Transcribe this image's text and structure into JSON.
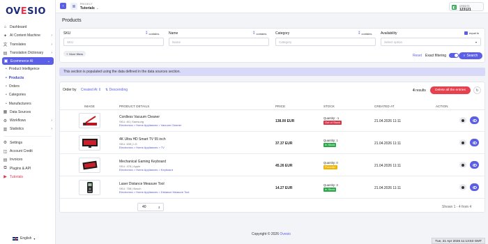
{
  "brand": {
    "logo_pre": "OV",
    "logo_o": "E",
    "logo_post": "SIO"
  },
  "sidebar": {
    "items": [
      {
        "label": "Dashboard",
        "icon": "home-icon"
      },
      {
        "label": "AI Content Machine",
        "icon": "sparkle-icon",
        "chevron": true
      },
      {
        "label": "Translates",
        "icon": "translate-icon",
        "chevron": true
      },
      {
        "label": "Translation Dictionary",
        "icon": "book-icon",
        "chevron": true
      },
      {
        "label": "Ecommerce AI",
        "icon": "cart-icon",
        "chevron": true,
        "active": true
      }
    ],
    "sub_items": [
      {
        "label": "Product Intelligence"
      },
      {
        "label": "Products",
        "active": true
      },
      {
        "label": "Orders"
      },
      {
        "label": "Categories"
      },
      {
        "label": "Manufacturers"
      }
    ],
    "items2": [
      {
        "label": "Data Sources",
        "icon": "database-icon"
      },
      {
        "label": "Workflows",
        "icon": "workflow-icon",
        "chevron": true
      },
      {
        "label": "Statistics",
        "icon": "chart-icon",
        "chevron": true
      }
    ],
    "items3": [
      {
        "label": "Settings",
        "icon": "gear-icon"
      },
      {
        "label": "Account Credit",
        "icon": "credit-icon"
      },
      {
        "label": "Invoices",
        "icon": "invoice-icon"
      },
      {
        "label": "Plugins & API",
        "icon": "plugin-icon"
      },
      {
        "label": "Tutorials",
        "icon": "youtube-icon"
      }
    ],
    "language": "English"
  },
  "topbar": {
    "project_label": "PROJECT",
    "project_name": "Tutorials",
    "credits_label": "CREDITS",
    "credits_value": "123121"
  },
  "page": {
    "title": "Products"
  },
  "filters": {
    "sku": {
      "label": "SKU",
      "mode": "contains",
      "placeholder": "SKU"
    },
    "name": {
      "label": "Name",
      "mode": "contains",
      "placeholder": "Name"
    },
    "category": {
      "label": "Category",
      "mode": "contains",
      "placeholder": "Category"
    },
    "availability": {
      "label": "Availability",
      "mode": "equal to",
      "placeholder": "Select option"
    },
    "more_filters": "More filters",
    "reset": "Reset",
    "exact_filtering": "Exact filtering",
    "search": "Search"
  },
  "info_banner": "This section is populated using the data defined in the data sources section.",
  "toolbar": {
    "order_by_label": "Order by",
    "order_by_value": "Created At",
    "direction": "Descending",
    "results_count": "4",
    "results_label": "results",
    "delete_all": "Delete all the entries"
  },
  "table": {
    "headers": [
      "IMAGE",
      "PRODUCT DETAILS",
      "PRICE",
      "STOCK",
      "CREATED AT",
      "ACTION"
    ],
    "rows": [
      {
        "name": "Cordless Vacuum Cleaner",
        "sku": "SKU: 84 | Samsung",
        "category": "Electronics > Home Appliances > Vacuum Cleaner",
        "price": "138.00 EUR",
        "quantity": "Quantity: -1",
        "stock": "Out of Stock",
        "stock_color": "#d7354a",
        "created": "21.04.2026 11:11"
      },
      {
        "name": "4K Ultra HD Smart TV 55 inch",
        "sku": "SKU: 635 | LG",
        "category": "Electronics > Home Appliances > TV",
        "price": "37.37 EUR",
        "quantity": "Quantity: 1",
        "stock": "In Stock",
        "stock_color": "#28a745",
        "created": "21.04.2026 11:11"
      },
      {
        "name": "Mechanical Gaming Keyboard",
        "sku": "SKU: 478 | Apple",
        "category": "Electronics > Home Appliances > Keyboard",
        "price": "45.26 EUR",
        "quantity": "Quantity: 0",
        "stock": "Preorder",
        "stock_color": "#f3b400",
        "created": "21.04.2026 11:11"
      },
      {
        "name": "Laser Distance Measure Tool",
        "sku": "SKU: 758 | Bosch",
        "category": "Electronics > Home Appliances > Distance Measure Tool",
        "price": "14.27 EUR",
        "quantity": "Quantity: 3",
        "stock": "In Stock",
        "stock_color": "#28a745",
        "created": "21.04.2026 11:11"
      }
    ]
  },
  "pagination": {
    "per_page": "40",
    "shown": "Shown 1 - 4 from 4"
  },
  "footer": {
    "copyright": "Copyright © 2026 ",
    "link": "Ovesio"
  },
  "clock": "Tue, 21 Apr 2026 11:13:53 GMT"
}
